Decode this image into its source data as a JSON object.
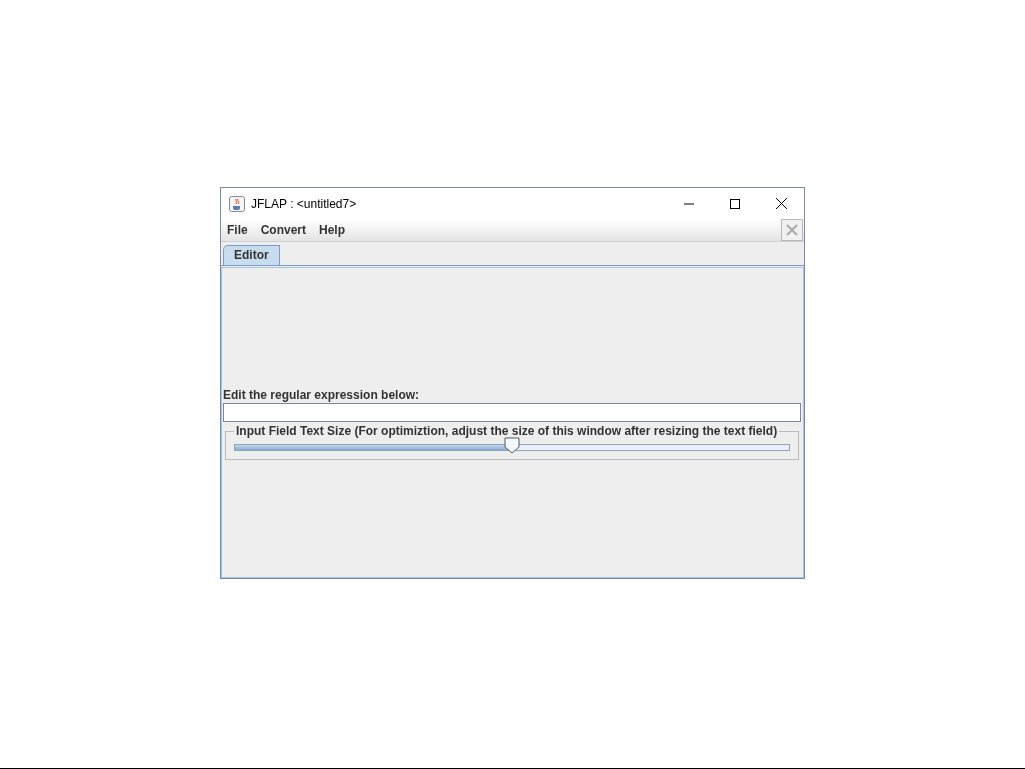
{
  "window": {
    "title": "JFLAP : <untitled7>"
  },
  "menu": [
    "File",
    "Convert",
    "Help"
  ],
  "tabs": [
    {
      "label": "Editor",
      "selected": true
    }
  ],
  "editor": {
    "label": "Edit the regular expression below:"
  },
  "slider": {
    "title": "Input Field Text Size (For optimiztion, adjust the size of this window after resizing the text field)",
    "level": 0.5
  }
}
